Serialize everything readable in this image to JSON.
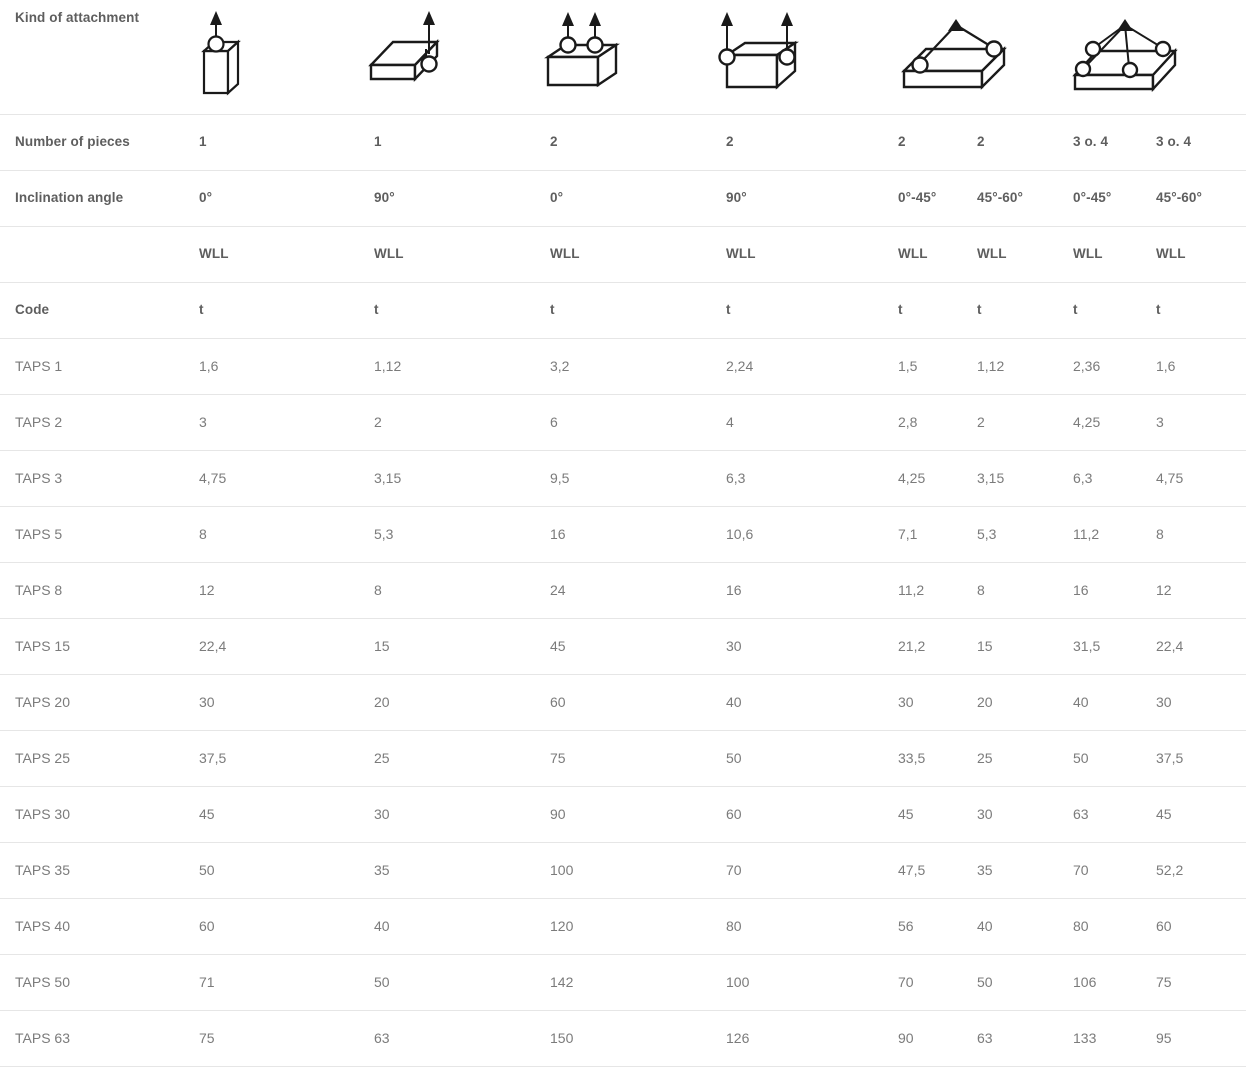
{
  "table": {
    "row_labels": {
      "kind_of_attachment": "Kind of attachment",
      "number_of_pieces": "Number of pieces",
      "inclination_angle": "Inclination angle",
      "wll_blank": "",
      "code": "Code"
    },
    "icons": [
      {
        "name": "single-leg-vertical-cube-icon",
        "description": "One lifting point with single arrow on a cube"
      },
      {
        "name": "single-leg-side-plate-icon",
        "description": "One lifting point at edge of flat plate, 90 degrees"
      },
      {
        "name": "two-leg-vertical-top-icon",
        "description": "Two lifting points with vertical arrows on top of block"
      },
      {
        "name": "two-leg-side-block-icon",
        "description": "Two lifting points at opposite sides of block, 90 degrees"
      },
      {
        "name": "two-leg-sling-plate-icon",
        "description": "Two slings converging to a hook above flat plate"
      },
      {
        "name": "four-leg-sling-plate-icon",
        "description": "Three or four slings converging to a hook above flat plate"
      }
    ],
    "columns": [
      {
        "pieces": "1",
        "angle": "0°",
        "wll": "WLL",
        "unit": "t"
      },
      {
        "pieces": "1",
        "angle": "90°",
        "wll": "WLL",
        "unit": "t"
      },
      {
        "pieces": "2",
        "angle": "0°",
        "wll": "WLL",
        "unit": "t"
      },
      {
        "pieces": "2",
        "angle": "90°",
        "wll": "WLL",
        "unit": "t"
      },
      {
        "pieces": "2",
        "angle": "0°-45°",
        "wll": "WLL",
        "unit": "t"
      },
      {
        "pieces": "2",
        "angle": "45°-60°",
        "wll": "WLL",
        "unit": "t"
      },
      {
        "pieces": "3 o. 4",
        "angle": "0°-45°",
        "wll": "WLL",
        "unit": "t"
      },
      {
        "pieces": "3 o. 4",
        "angle": "45°-60°",
        "wll": "WLL",
        "unit": "t"
      }
    ],
    "rows": [
      {
        "code": "TAPS 1",
        "values": [
          "1,6",
          "1,12",
          "3,2",
          "2,24",
          "1,5",
          "1,12",
          "2,36",
          "1,6"
        ]
      },
      {
        "code": "TAPS 2",
        "values": [
          "3",
          "2",
          "6",
          "4",
          "2,8",
          "2",
          "4,25",
          "3"
        ]
      },
      {
        "code": "TAPS 3",
        "values": [
          "4,75",
          "3,15",
          "9,5",
          "6,3",
          "4,25",
          "3,15",
          "6,3",
          "4,75"
        ]
      },
      {
        "code": "TAPS 5",
        "values": [
          "8",
          "5,3",
          "16",
          "10,6",
          "7,1",
          "5,3",
          "11,2",
          "8"
        ]
      },
      {
        "code": "TAPS 8",
        "values": [
          "12",
          "8",
          "24",
          "16",
          "11,2",
          "8",
          "16",
          "12"
        ]
      },
      {
        "code": "TAPS 15",
        "values": [
          "22,4",
          "15",
          "45",
          "30",
          "21,2",
          "15",
          "31,5",
          "22,4"
        ]
      },
      {
        "code": "TAPS 20",
        "values": [
          "30",
          "20",
          "60",
          "40",
          "30",
          "20",
          "40",
          "30"
        ]
      },
      {
        "code": "TAPS 25",
        "values": [
          "37,5",
          "25",
          "75",
          "50",
          "33,5",
          "25",
          "50",
          "37,5"
        ]
      },
      {
        "code": "TAPS 30",
        "values": [
          "45",
          "30",
          "90",
          "60",
          "45",
          "30",
          "63",
          "45"
        ]
      },
      {
        "code": "TAPS 35",
        "values": [
          "50",
          "35",
          "100",
          "70",
          "47,5",
          "35",
          "70",
          "52,2"
        ]
      },
      {
        "code": "TAPS 40",
        "values": [
          "60",
          "40",
          "120",
          "80",
          "56",
          "40",
          "80",
          "60"
        ]
      },
      {
        "code": "TAPS 50",
        "values": [
          "71",
          "50",
          "142",
          "100",
          "70",
          "50",
          "106",
          "75"
        ]
      },
      {
        "code": "TAPS 63",
        "values": [
          "75",
          "63",
          "150",
          "126",
          "90",
          "63",
          "133",
          "95"
        ]
      }
    ]
  },
  "colors": {
    "header_text": "#5e5e5e",
    "body_text": "#7b7b7b",
    "row_divider": "#e6e6e6",
    "background": "#ffffff",
    "icon_stroke": "#1a1a1a"
  }
}
